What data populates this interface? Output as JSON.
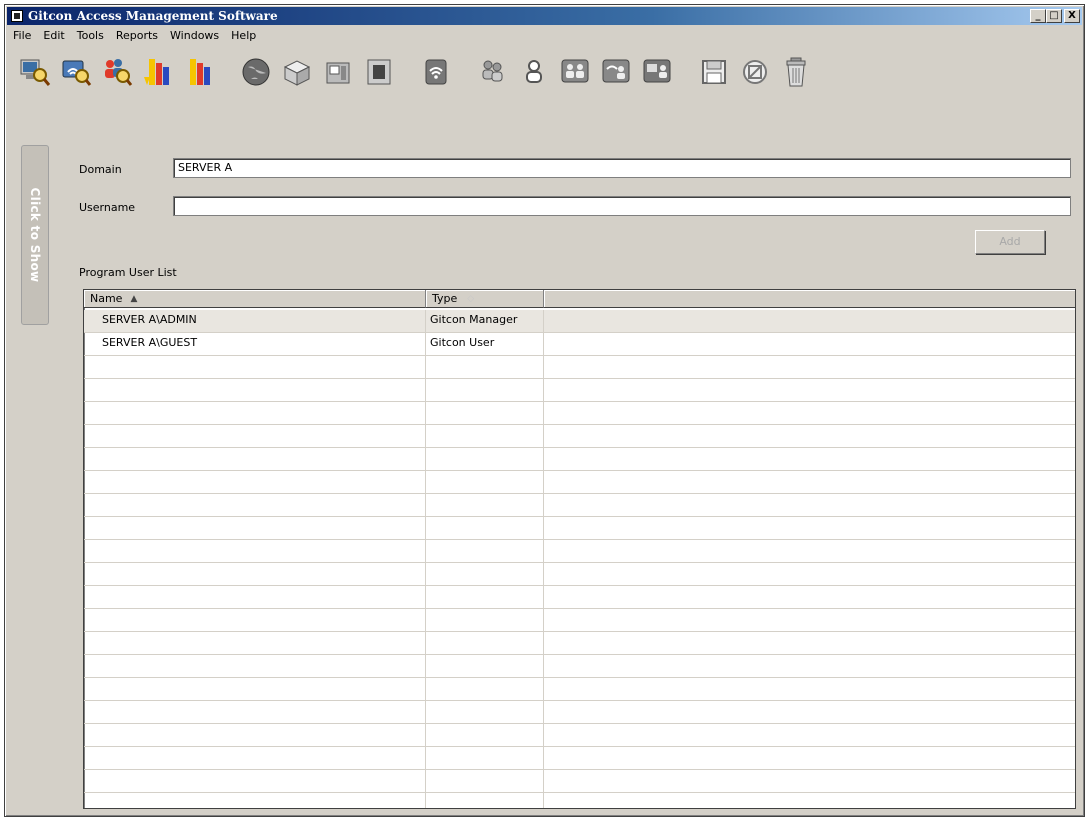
{
  "window": {
    "title": "Gitcon Access Management Software",
    "minimize": "_",
    "maximize": "□",
    "close": "X"
  },
  "menu": [
    {
      "label": "File"
    },
    {
      "label": "Edit"
    },
    {
      "label": "Tools"
    },
    {
      "label": "Reports"
    },
    {
      "label": "Windows"
    },
    {
      "label": "Help"
    }
  ],
  "toolbar": {
    "icons": [
      "computer-search-icon",
      "network-search-icon",
      "users-search-icon",
      "report-az-icon",
      "report-icon",
      "globe-icon",
      "server-icon",
      "card-reader-icon",
      "terminal-icon",
      "wifi-icon",
      "user-group-icon",
      "user-icon",
      "users-multi-icon",
      "users-wifi-icon",
      "users-network-icon",
      "save-icon",
      "cancel-icon",
      "trash-icon"
    ]
  },
  "side_tab": {
    "label": "Click to Show"
  },
  "form": {
    "domain_label": "Domain",
    "domain_value": "SERVER A",
    "username_label": "Username",
    "username_value": "",
    "add_label": "Add"
  },
  "list": {
    "title": "Program User List",
    "columns": [
      "Name",
      "Type",
      ""
    ],
    "sort_asc": "▲",
    "sort_none": "◇",
    "rows": [
      {
        "name": "SERVER A\\ADMIN",
        "type": "Gitcon Manager"
      },
      {
        "name": "SERVER A\\GUEST",
        "type": "Gitcon User"
      }
    ]
  },
  "colors": {
    "title_gradient_start": "#0a246a",
    "title_gradient_end": "#a6caf0",
    "window_bg": "#d4d0c8"
  }
}
